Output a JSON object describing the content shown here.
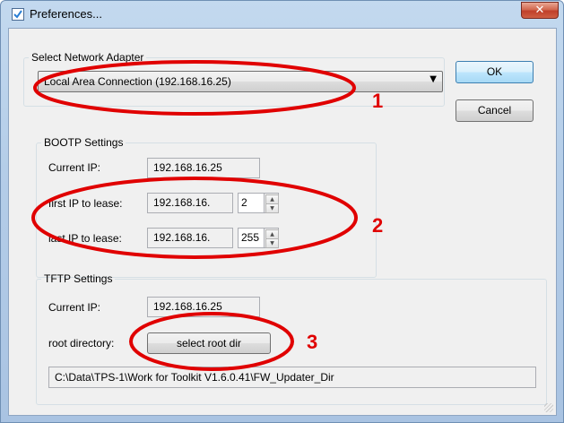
{
  "window": {
    "title": "Preferences...",
    "close_glyph": "✕"
  },
  "network_adapter": {
    "legend": "Select Network Adapter",
    "selected": "Local Area Connection (192.168.16.25)",
    "arrow": "▼"
  },
  "buttons": {
    "ok": "OK",
    "cancel": "Cancel"
  },
  "bootp": {
    "legend": "BOOTP Settings",
    "current_ip_label": "Current IP:",
    "current_ip": "192.168.16.25",
    "first_label": "first IP to lease:",
    "first_prefix": "192.168.16.",
    "first_value": "2",
    "last_label": "last IP to lease:",
    "last_prefix": "192.168.16.",
    "last_value": "255"
  },
  "tftp": {
    "legend": "TFTP Settings",
    "current_ip_label": "Current IP:",
    "current_ip": "192.168.16.25",
    "root_label": "root directory:",
    "select_button": "select root dir",
    "path": "C:\\Data\\TPS-1\\Work for Toolkit V1.6.0.41\\FW_Updater_Dir"
  },
  "spinner": {
    "up": "▲",
    "down": "▼"
  },
  "annotations": {
    "one": "1",
    "two": "2",
    "three": "3",
    "color": "#e00000"
  },
  "icons": {
    "app": "checkmark-icon",
    "close": "close-icon",
    "dropdown": "chevron-down-icon",
    "resize": "resize-grip-icon"
  }
}
